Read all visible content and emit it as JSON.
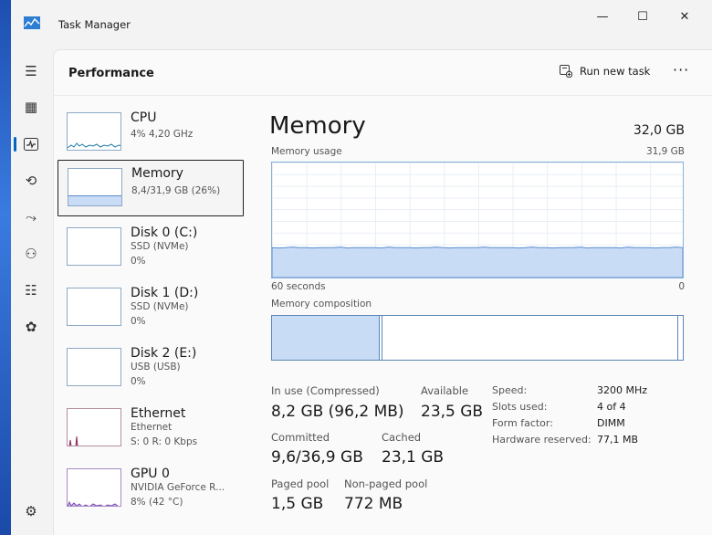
{
  "window": {
    "title": "Task Manager",
    "minimize": "—",
    "maximize": "☐",
    "close": "✕"
  },
  "header": {
    "section_title": "Performance",
    "run_new_task": "Run new task",
    "more": "···"
  },
  "nav": {
    "menu": "☰",
    "processes": "▦",
    "performance": "⬚",
    "app_history": "⟲",
    "startup": "⤳",
    "users": "⚇",
    "details": "☷",
    "services": "✿",
    "settings": "⚙"
  },
  "devices": [
    {
      "name": "CPU",
      "sub1": "4%  4,20 GHz",
      "sub2": ""
    },
    {
      "name": "Memory",
      "sub1": "8,4/31,9 GB (26%)",
      "sub2": ""
    },
    {
      "name": "Disk 0 (C:)",
      "sub1": "SSD (NVMe)",
      "sub2": "0%"
    },
    {
      "name": "Disk 1 (D:)",
      "sub1": "SSD (NVMe)",
      "sub2": "0%"
    },
    {
      "name": "Disk 2 (E:)",
      "sub1": "USB (USB)",
      "sub2": "0%"
    },
    {
      "name": "Ethernet",
      "sub1": "Ethernet",
      "sub2": "S: 0 R: 0 Kbps"
    },
    {
      "name": "GPU 0",
      "sub1": "NVIDIA GeForce R...",
      "sub2": "8% (42 °C)"
    }
  ],
  "detail": {
    "title": "Memory",
    "total": "32,0 GB",
    "usage_label": "Memory usage",
    "usage_max": "31,9 GB",
    "time_left": "60 seconds",
    "time_right": "0",
    "composition_label": "Memory composition",
    "usage_fraction": 0.26
  },
  "stats": {
    "in_use_label": "In use (Compressed)",
    "in_use_value": "8,2 GB (96,2 MB)",
    "available_label": "Available",
    "available_value": "23,5 GB",
    "committed_label": "Committed",
    "committed_value": "9,6/36,9 GB",
    "cached_label": "Cached",
    "cached_value": "23,1 GB",
    "paged_label": "Paged pool",
    "paged_value": "1,5 GB",
    "nonpaged_label": "Non-paged pool",
    "nonpaged_value": "772 MB"
  },
  "specs": [
    {
      "key": "Speed:",
      "value": "3200 MHz"
    },
    {
      "key": "Slots used:",
      "value": "4 of 4"
    },
    {
      "key": "Form factor:",
      "value": "DIMM"
    },
    {
      "key": "Hardware reserved:",
      "value": "77,1 MB"
    }
  ],
  "colors": {
    "accent": "#0067c0",
    "memory_fill": "#c9dcf5",
    "memory_line": "#5a8ccf"
  }
}
